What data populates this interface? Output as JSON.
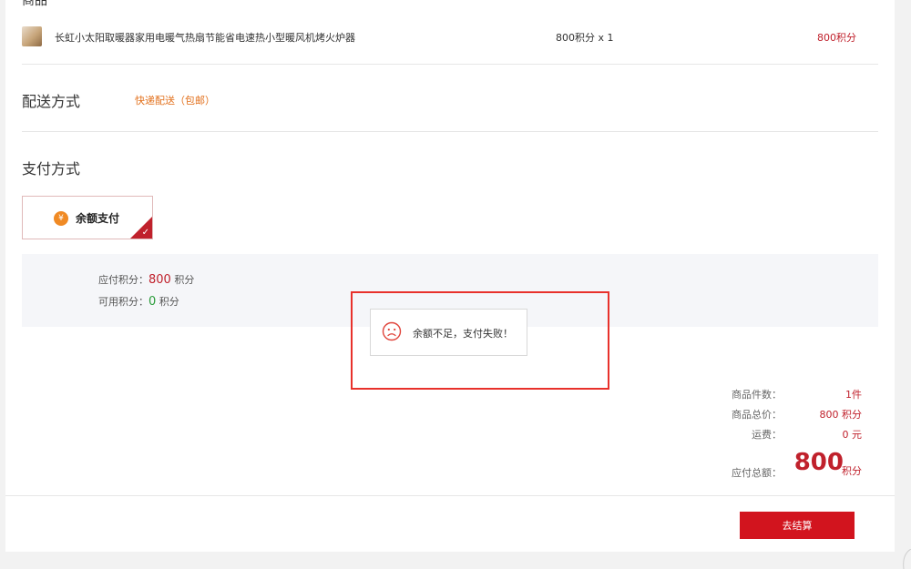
{
  "product_section": {
    "label": "商品",
    "item": {
      "name": "长虹小太阳取暖器家用电暖气热扇节能省电速热小型暖风机烤火炉器",
      "qty_text": "800积分 x 1",
      "price": "800积分"
    }
  },
  "delivery": {
    "label": "配送方式",
    "option": "快递配送（包邮）"
  },
  "payment": {
    "label": "支付方式",
    "method": "余额支付",
    "icon": "money-bag-icon"
  },
  "balance": {
    "due_label": "应付积分：",
    "due_value": "800",
    "due_unit": "积分",
    "available_label": "可用积分：",
    "available_value": "0",
    "available_unit": "积分"
  },
  "toast": {
    "icon": "sad-face-icon",
    "message": "余额不足，支付失败！"
  },
  "summary": {
    "count_label": "商品件数：",
    "count_value": "1件",
    "total_label": "商品总价：",
    "total_value": "800 积分",
    "shipping_label": "运费：",
    "shipping_value": "0 元",
    "payable_label": "应付总额：",
    "payable_amount": "800",
    "payable_unit": "积分"
  },
  "checkout": {
    "label": "去结算"
  },
  "colors": {
    "accent_red": "#c0212c",
    "button_red": "#d2141e",
    "delivery_orange": "#e2701c",
    "green": "#2a9c3a"
  }
}
